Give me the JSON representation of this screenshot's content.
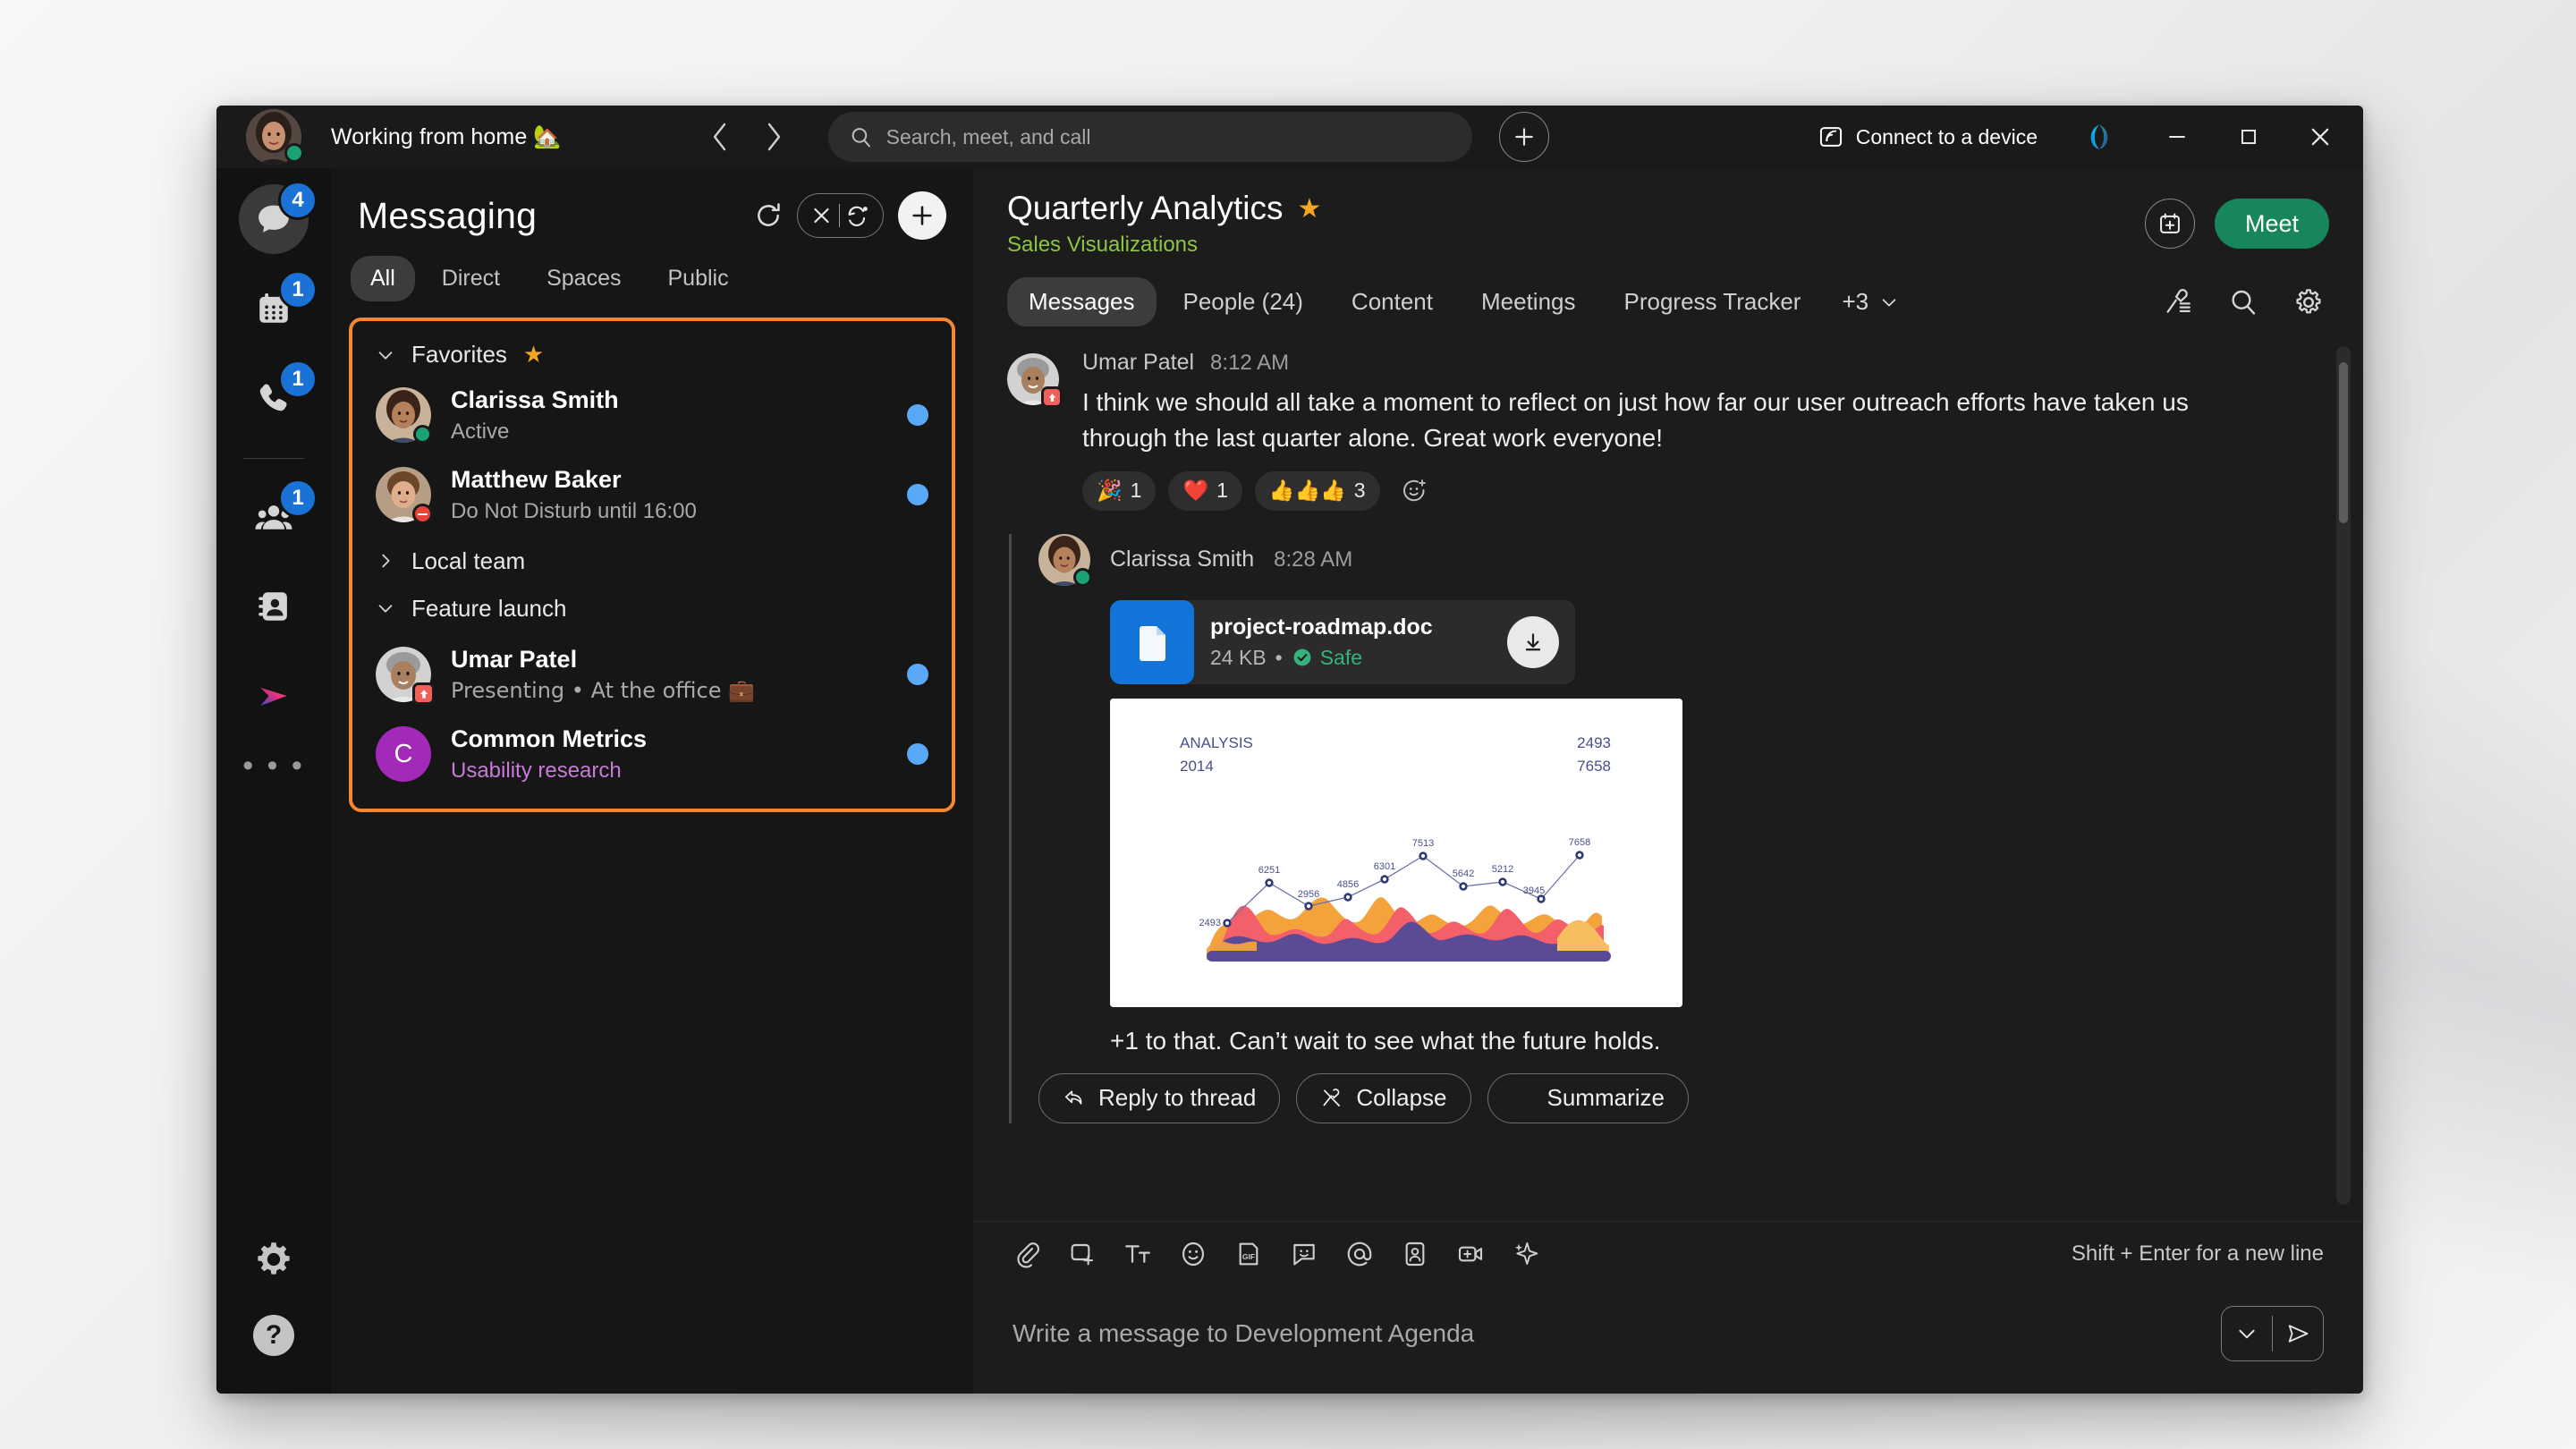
{
  "titlebar": {
    "status_text": "Working from home 🏡",
    "search_placeholder": "Search, meet, and call",
    "connect_label": "Connect to a device",
    "back_icon": "chevron-left-icon",
    "forward_icon": "chevron-right-icon",
    "add_icon": "plus-icon",
    "minimize_icon": "minimize-icon",
    "maximize_icon": "maximize-icon",
    "close_icon": "close-icon"
  },
  "rail": {
    "items": [
      {
        "name": "messaging",
        "icon": "chat-bubble-icon",
        "badge": "4",
        "selected": true
      },
      {
        "name": "meetings",
        "icon": "calendar-icon",
        "badge": "1",
        "selected": false
      },
      {
        "name": "calling",
        "icon": "phone-icon",
        "badge": "1",
        "selected": false
      },
      {
        "name": "contacts-teams",
        "icon": "people-icon",
        "badge": "1",
        "selected": false
      },
      {
        "name": "contact-card",
        "icon": "contact-book-icon",
        "badge": "",
        "selected": false
      },
      {
        "name": "vidcast",
        "icon": "vidcast-play-icon",
        "badge": "",
        "selected": false
      }
    ],
    "more_label": "• • •",
    "settings_icon": "gear-icon",
    "help_label": "?"
  },
  "messaging_panel": {
    "title": "Messaging",
    "refresh_icon": "refresh-icon",
    "markread_icon": "mark-all-read-icon",
    "filter_icon": "filter-icon",
    "new_icon": "plus-icon",
    "tabs": [
      {
        "label": "All",
        "selected": true
      },
      {
        "label": "Direct",
        "selected": false
      },
      {
        "label": "Spaces",
        "selected": false
      },
      {
        "label": "Public",
        "selected": false
      }
    ],
    "groups": [
      {
        "label": "Favorites",
        "star": "★",
        "expanded": true
      },
      {
        "label": "Local team",
        "star": "",
        "expanded": false
      },
      {
        "label": "Feature launch",
        "star": "",
        "expanded": true
      }
    ],
    "contacts_favorites": [
      {
        "name": "Clarissa Smith",
        "sub": "Active",
        "presence": "active",
        "unread": true,
        "sub_style": "normal"
      },
      {
        "name": "Matthew Baker",
        "sub": "Do Not Disturb until 16:00",
        "presence": "dnd",
        "unread": true,
        "sub_style": "normal"
      }
    ],
    "contacts_feature_launch": [
      {
        "name": "Umar Patel",
        "sub": "Presenting  •  At the office 💼",
        "presence": "present",
        "unread": true,
        "sub_style": "normal"
      },
      {
        "name": "Common Metrics",
        "sub": "Usability research",
        "presence": "none",
        "unread": true,
        "sub_style": "purple",
        "initial": "C"
      }
    ]
  },
  "chat": {
    "title": "Quarterly Analytics",
    "star": "★",
    "subtitle": "Sales Visualizations",
    "schedule_icon": "calendar-plus-icon",
    "meet_label": "Meet",
    "tabs": [
      {
        "label": "Messages",
        "selected": true
      },
      {
        "label": "People (24)",
        "selected": false
      },
      {
        "label": "Content",
        "selected": false
      },
      {
        "label": "Meetings",
        "selected": false
      },
      {
        "label": "Progress Tracker",
        "selected": false
      }
    ],
    "tabs_overflow": "+3",
    "overflow_icon": "chevron-down-icon",
    "pin_icon": "pin-list-icon",
    "search_icon": "search-icon",
    "settings_icon": "gear-icon",
    "messages": [
      {
        "author": "Umar Patel",
        "time": "8:12 AM",
        "text": "I think we should all take a moment to reflect on just how far our user outreach efforts have taken us through the last quarter alone. Great work everyone!",
        "reactions": [
          {
            "emoji": "🎉",
            "count": "1"
          },
          {
            "emoji": "❤️",
            "count": "1"
          },
          {
            "emoji": "👍👍👍",
            "count": "3"
          }
        ],
        "add_reaction_icon": "add-reaction-icon"
      }
    ],
    "thread": {
      "author": "Clarissa Smith",
      "time": "8:28 AM",
      "file": {
        "name": "project-roadmap.doc",
        "size": "24 KB",
        "separator": "•",
        "safety": "Safe",
        "doc_icon": "document-icon",
        "check_icon": "check-circle-icon",
        "download_icon": "download-icon"
      },
      "reply_text": "+1 to that. Can’t wait to see what the future holds.",
      "actions": [
        {
          "label": "Reply to thread",
          "icon": "reply-icon"
        },
        {
          "label": "Collapse",
          "icon": "collapse-eye-icon"
        },
        {
          "label": "Summarize",
          "icon": "summarize-ai-icon"
        }
      ]
    }
  },
  "chart_data": {
    "type": "area",
    "title": "ANALYSIS",
    "subtitle": "2014",
    "corner_values": [
      "2493",
      "7658"
    ],
    "xlabel": "",
    "ylabel": "",
    "grid": false,
    "legend": "none",
    "ylim": [
      0,
      8000
    ],
    "categories": [
      "1",
      "2",
      "3",
      "4",
      "5",
      "6",
      "7",
      "8",
      "9",
      "10"
    ],
    "series": [
      {
        "name": "Analysis",
        "values": [
          2493,
          6251,
          2956,
          4856,
          6301,
          7513,
          5642,
          5212,
          3945,
          7658
        ],
        "color": "#2f3b7a"
      }
    ],
    "point_labels": [
      "2493",
      "6251",
      "2956",
      "4856",
      "6301",
      "7513",
      "5642",
      "5212",
      "3945",
      "7658"
    ],
    "area_colors": [
      "#5b4a96",
      "#f4a23c",
      "#f4606a",
      "#f7bd5f"
    ]
  },
  "composer": {
    "tools": [
      {
        "name": "attach-file",
        "icon": "paperclip-icon"
      },
      {
        "name": "screen-capture",
        "icon": "screen-capture-icon"
      },
      {
        "name": "format-text",
        "icon": "format-text-icon"
      },
      {
        "name": "emoji",
        "icon": "emoji-icon"
      },
      {
        "name": "gif",
        "icon": "gif-icon"
      },
      {
        "name": "sticker",
        "icon": "sticker-icon"
      },
      {
        "name": "mention",
        "icon": "at-mention-icon"
      },
      {
        "name": "personal-card",
        "icon": "person-card-icon"
      },
      {
        "name": "add-video",
        "icon": "add-video-icon"
      },
      {
        "name": "ai-assist",
        "icon": "sparkle-ai-icon"
      }
    ],
    "hint": "Shift + Enter for a new line",
    "placeholder": "Write a message to Development Agenda",
    "expand_icon": "chevron-down-icon",
    "send_icon": "send-icon"
  },
  "colors": {
    "accent_orange": "#f58634",
    "brand_green": "#17865c",
    "badge_blue": "#1a72d6",
    "unread_blue": "#5aa9f8",
    "subtitle_green": "#8cc63f",
    "star_gold": "#f5a623",
    "purple_avatar": "#a32ab8"
  }
}
